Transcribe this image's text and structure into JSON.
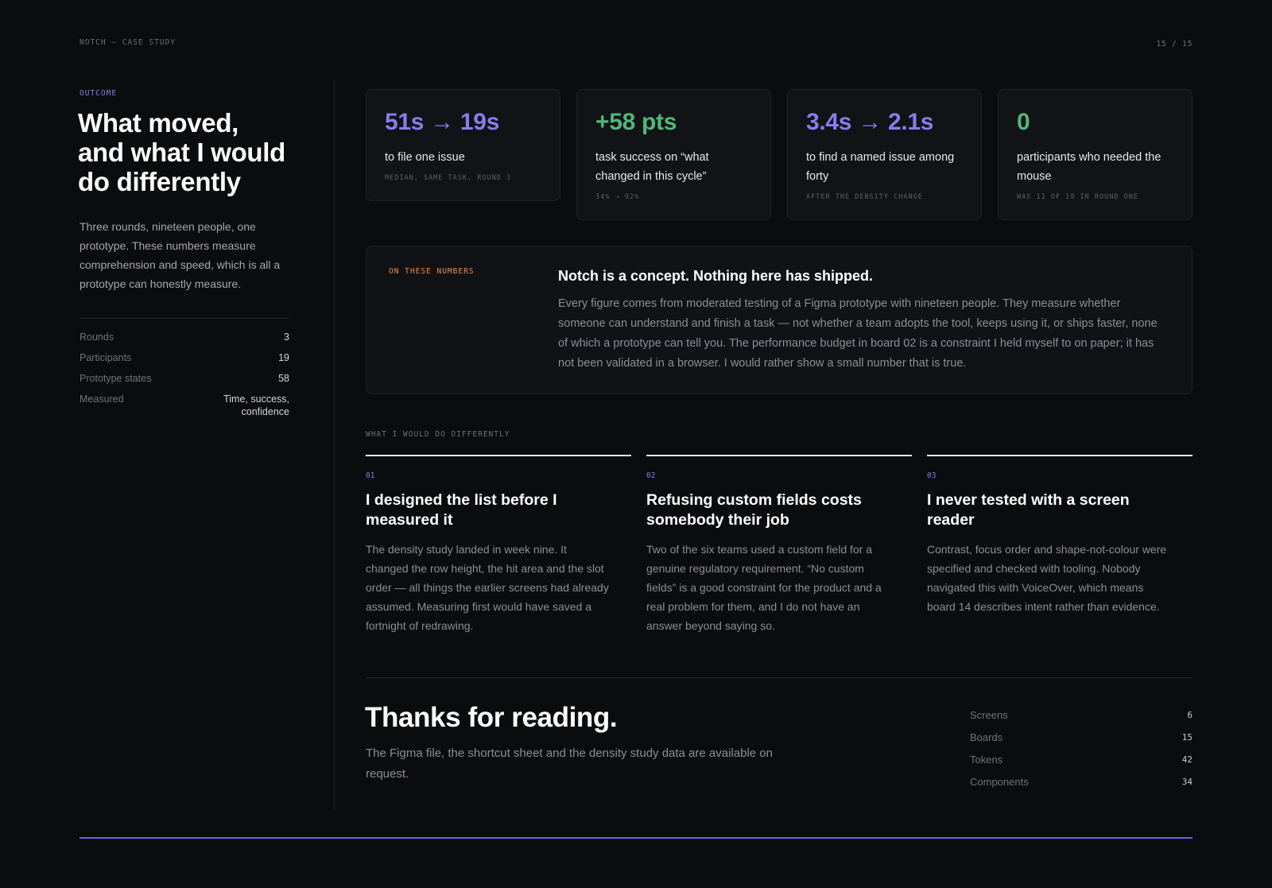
{
  "header": {
    "left": "NOTCH — CASE STUDY",
    "page_indicator": "15 / 15"
  },
  "left": {
    "eyebrow": "OUTCOME",
    "title": "What moved, and what I would do differently",
    "intro": "Three rounds, nineteen people, one prototype. These numbers measure comprehension and speed, which is all a prototype can honestly measure.",
    "stats": [
      {
        "label": "Rounds",
        "value": "3"
      },
      {
        "label": "Participants",
        "value": "19"
      },
      {
        "label": "Prototype states",
        "value": "58"
      },
      {
        "label": "Measured",
        "value": "Time, success, confidence"
      }
    ]
  },
  "metrics": [
    {
      "big": "51s → 19s",
      "desc": "to file one issue",
      "note": "MEDIAN, SAME TASK, ROUND 3",
      "color": "#8b7bf0"
    },
    {
      "big": "+58 pts",
      "desc": "task success on “what changed in this cycle”",
      "note": "34% → 92%",
      "color": "#4fb87a"
    },
    {
      "big": "3.4s → 2.1s",
      "desc": "to find a named issue among forty",
      "note": "AFTER THE DENSITY CHANGE",
      "color": "#8b7bf0"
    },
    {
      "big": "0",
      "desc": "participants who needed the mouse",
      "note": "WAS 11 OF 19 IN ROUND ONE",
      "color": "#4fb87a"
    }
  ],
  "note_card": {
    "label": "ON THESE NUMBERS",
    "heading": "Notch is a concept. Nothing here has shipped.",
    "body": "Every figure comes from moderated testing of a Figma prototype with nineteen people. They measure whether someone can understand and finish a task — not whether a team adopts the tool, keeps using it, or ships faster, none of which a prototype can tell you. The performance budget in board 02 is a constraint I held myself to on paper; it has not been validated in a browser. I would rather show a small number that is true."
  },
  "differently": {
    "label": "WHAT I WOULD DO DIFFERENTLY",
    "items": [
      {
        "num": "01",
        "heading": "I designed the list before I measured it",
        "body": "The density study landed in week nine. It changed the row height, the hit area and the slot order — all things the earlier screens had already assumed. Measuring first would have saved a fortnight of redrawing."
      },
      {
        "num": "02",
        "heading": "Refusing custom fields costs somebody their job",
        "body": "Two of the six teams used a custom field for a genuine regulatory requirement. “No custom fields” is a good constraint for the product and a real problem for them, and I do not have an answer beyond saying so."
      },
      {
        "num": "03",
        "heading": "I never tested with a screen reader",
        "body": "Contrast, focus order and shape-not-colour were specified and checked with tooling. Nobody navigated this with VoiceOver, which means board 14 describes intent rather than evidence."
      }
    ]
  },
  "closing": {
    "title": "Thanks for reading.",
    "subtitle": "The Figma file, the shortcut sheet and the density study data are available on request.",
    "totals": [
      {
        "label": "Screens",
        "value": "6"
      },
      {
        "label": "Boards",
        "value": "15"
      },
      {
        "label": "Tokens",
        "value": "42"
      },
      {
        "label": "Components",
        "value": "34"
      }
    ]
  },
  "colors": {
    "accent_purple": "#8b7bf0",
    "accent_green": "#4fb87a",
    "accent_orange": "#e58f4a",
    "bottom_bar": "#6d63d8"
  }
}
